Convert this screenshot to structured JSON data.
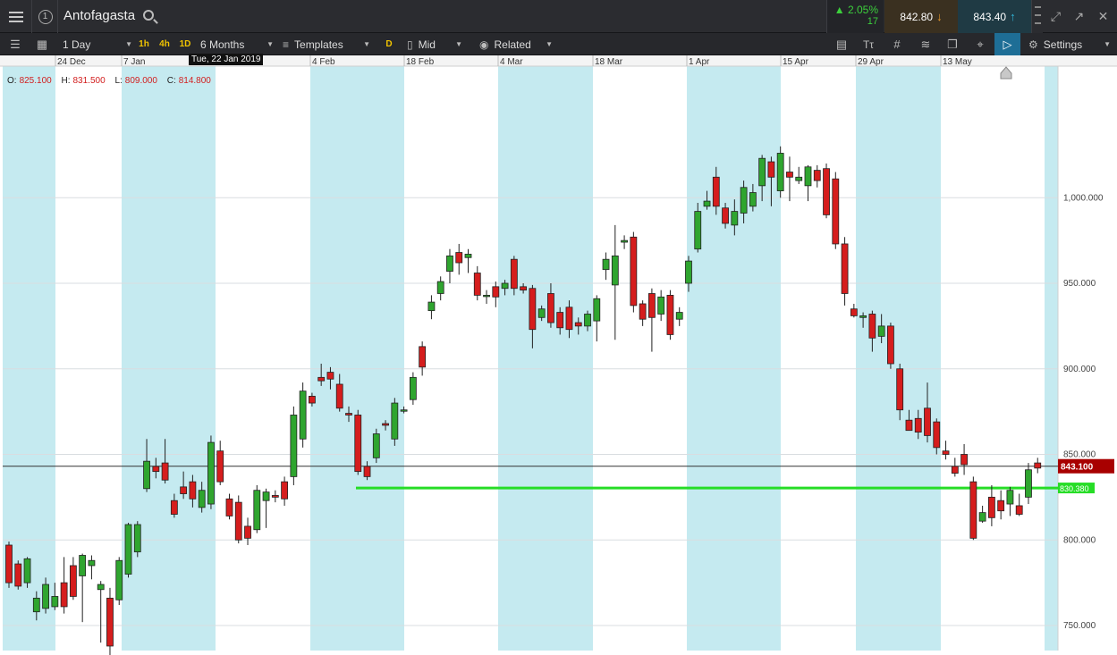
{
  "titlebar": {
    "instrument": "Antofagasta",
    "change_pct": "2.05%",
    "change_abs": "17",
    "sell_price": "842.80",
    "buy_price": "843.40"
  },
  "toolbar": {
    "interval": "1 Day",
    "quick_1h": "1h",
    "quick_4h": "4h",
    "quick_1d": "1D",
    "range": "6 Months",
    "templates": "Templates",
    "d_button": "D",
    "price_type": "Mid",
    "related": "Related",
    "settings": "Settings"
  },
  "ohlc": {
    "o_label": "O:",
    "o": "825.100",
    "h_label": "H:",
    "h": "831.500",
    "l_label": "L:",
    "l": "809.000",
    "c_label": "C:",
    "c": "814.800"
  },
  "date_tooltip": "Tue, 22 Jan 2019",
  "colors": {
    "up": "#2fa52f",
    "down": "#d51d1d",
    "band": "#c5eaf0",
    "support": "#26dd26",
    "current": "#a80000"
  },
  "chart_data": {
    "type": "candlestick",
    "x_ticks": [
      "24 Dec",
      "7 Jan",
      "4 Feb",
      "18 Feb",
      "4 Mar",
      "18 Mar",
      "1 Apr",
      "15 Apr",
      "29 Apr",
      "13 May"
    ],
    "y_ticks": [
      "750.000",
      "800.000",
      "850.000",
      "900.000",
      "950.000",
      "1,000.000"
    ],
    "y_tick_values": [
      750,
      800,
      850,
      900,
      950,
      1000
    ],
    "ylim": [
      715,
      1040
    ],
    "current_price": 843.1,
    "current_price_label": "843.100",
    "support_level": 830.38,
    "support_label": "830.380",
    "candles": [
      [
        797,
        775,
        799,
        772
      ],
      [
        786,
        773,
        788,
        771
      ],
      [
        775,
        789,
        790,
        772
      ],
      [
        758,
        766,
        770,
        753
      ],
      [
        760,
        774,
        778,
        757
      ],
      [
        761,
        767,
        775,
        759
      ],
      [
        775,
        761,
        790,
        757
      ],
      [
        785,
        767,
        790,
        765
      ],
      [
        779,
        791,
        792,
        752
      ],
      [
        785,
        788,
        791,
        777
      ],
      [
        771,
        774,
        776,
        740
      ],
      [
        766,
        738,
        772,
        729
      ],
      [
        765,
        788,
        790,
        762
      ],
      [
        780,
        809,
        810,
        778
      ],
      [
        793,
        809,
        811,
        790
      ],
      [
        830,
        846,
        859,
        828
      ],
      [
        843,
        840,
        848,
        836
      ],
      [
        845,
        835,
        859,
        833
      ],
      [
        823,
        815,
        827,
        813
      ],
      [
        831,
        827,
        840,
        824
      ],
      [
        834,
        824,
        838,
        819
      ],
      [
        819,
        829,
        834,
        816
      ],
      [
        821,
        857,
        861,
        818
      ],
      [
        852,
        834,
        858,
        832
      ],
      [
        824,
        814,
        827,
        812
      ],
      [
        822,
        800,
        826,
        798
      ],
      [
        808,
        801,
        813,
        797
      ],
      [
        806,
        829,
        832,
        804
      ],
      [
        823,
        828,
        830,
        807
      ],
      [
        826,
        825,
        829,
        822
      ],
      [
        834,
        824,
        837,
        820
      ],
      [
        837,
        873,
        878,
        832
      ],
      [
        859,
        887,
        892,
        854
      ],
      [
        884,
        880,
        886,
        878
      ],
      [
        895,
        893,
        903,
        890
      ],
      [
        898,
        894,
        901,
        888
      ],
      [
        891,
        877,
        897,
        875
      ],
      [
        874,
        873,
        878,
        869
      ],
      [
        873,
        840,
        876,
        838
      ],
      [
        843,
        837,
        846,
        835
      ],
      [
        848,
        862,
        865,
        845
      ],
      [
        868,
        867,
        870,
        864
      ],
      [
        859,
        880,
        883,
        855
      ],
      [
        876,
        876,
        878,
        874
      ],
      [
        882,
        895,
        898,
        879
      ],
      [
        913,
        901,
        916,
        896
      ],
      [
        934,
        939,
        943,
        929
      ],
      [
        944,
        951,
        954,
        940
      ],
      [
        957,
        966,
        970,
        950
      ],
      [
        968,
        962,
        973,
        955
      ],
      [
        965,
        967,
        970,
        956
      ],
      [
        956,
        943,
        960,
        940
      ],
      [
        943,
        943,
        946,
        938
      ],
      [
        948,
        942,
        951,
        936
      ],
      [
        947,
        950,
        952,
        943
      ],
      [
        964,
        947,
        966,
        943
      ],
      [
        948,
        946,
        950,
        944
      ],
      [
        947,
        923,
        949,
        912
      ],
      [
        930,
        935,
        937,
        928
      ],
      [
        944,
        927,
        950,
        924
      ],
      [
        933,
        924,
        936,
        920
      ],
      [
        936,
        923,
        940,
        918
      ],
      [
        927,
        925,
        930,
        920
      ],
      [
        925,
        932,
        934,
        922
      ],
      [
        928,
        941,
        943,
        916
      ],
      [
        958,
        964,
        968,
        952
      ],
      [
        949,
        966,
        984,
        917
      ],
      [
        974,
        975,
        978,
        970
      ],
      [
        977,
        937,
        980,
        933
      ],
      [
        938,
        929,
        940,
        925
      ],
      [
        944,
        930,
        947,
        910
      ],
      [
        932,
        942,
        946,
        928
      ],
      [
        943,
        920,
        946,
        917
      ],
      [
        929,
        933,
        936,
        925
      ],
      [
        950,
        963,
        966,
        945
      ],
      [
        970,
        992,
        997,
        968
      ],
      [
        995,
        998,
        1004,
        993
      ],
      [
        1012,
        995,
        1018,
        990
      ],
      [
        994,
        985,
        997,
        982
      ],
      [
        984,
        992,
        999,
        978
      ],
      [
        991,
        1006,
        1010,
        985
      ],
      [
        995,
        1003,
        1008,
        992
      ],
      [
        1007,
        1023,
        1025,
        998
      ],
      [
        1021,
        1012,
        1024,
        995
      ],
      [
        1004,
        1026,
        1030,
        1000
      ],
      [
        1015,
        1012,
        1024,
        998
      ],
      [
        1010,
        1012,
        1018,
        1008
      ],
      [
        1007,
        1018,
        1019,
        998
      ],
      [
        1016,
        1010,
        1019,
        1006
      ],
      [
        1017,
        990,
        1020,
        988
      ],
      [
        1011,
        973,
        1015,
        970
      ],
      [
        973,
        944,
        977,
        937
      ],
      [
        935,
        931,
        938,
        930
      ],
      [
        930,
        931,
        933,
        924
      ],
      [
        932,
        918,
        934,
        910
      ],
      [
        919,
        925,
        932,
        915
      ],
      [
        925,
        903,
        927,
        900
      ],
      [
        900,
        876,
        903,
        870
      ],
      [
        870,
        864,
        876,
        865
      ],
      [
        871,
        863,
        876,
        859
      ],
      [
        877,
        861,
        892,
        857
      ],
      [
        869,
        854,
        871,
        850
      ],
      [
        852,
        850,
        858,
        847
      ],
      [
        843,
        839,
        848,
        837
      ],
      [
        850,
        844,
        856,
        838
      ],
      [
        834,
        801,
        837,
        800
      ],
      [
        811,
        816,
        820,
        810
      ],
      [
        825,
        813,
        832,
        808
      ],
      [
        823,
        817,
        829,
        812
      ],
      [
        821,
        829,
        831,
        814
      ],
      [
        820,
        815,
        827,
        814
      ],
      [
        825,
        841,
        845,
        821
      ],
      [
        845,
        842,
        848,
        839
      ]
    ]
  }
}
